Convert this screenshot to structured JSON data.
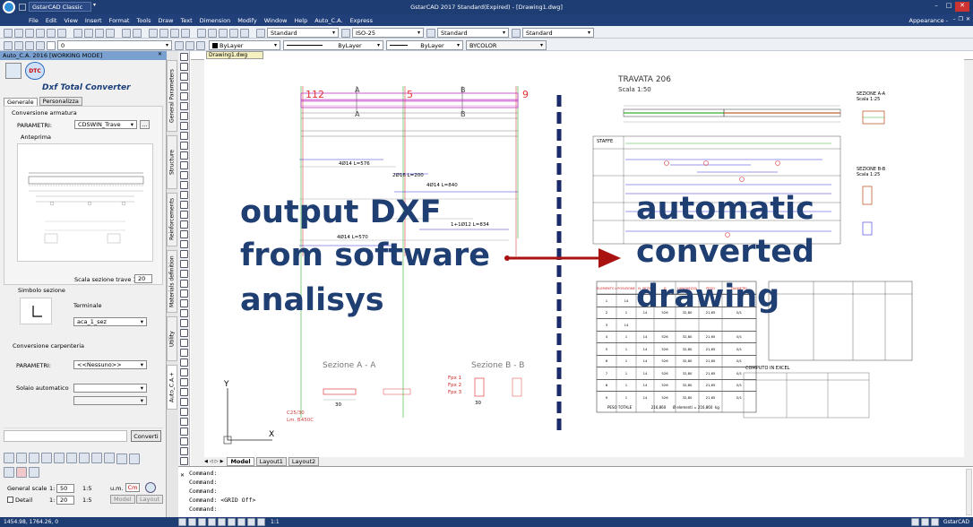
{
  "title": {
    "app_icon": "gstarcad-logo-icon",
    "workspace": "GstarCAD Classic",
    "window_title": "GstarCAD 2017 Standard(Expired) - [Drawing1.dwg]",
    "right": "Appearance -"
  },
  "menu": [
    "File",
    "Edit",
    "View",
    "Insert",
    "Format",
    "Tools",
    "Draw",
    "Text",
    "Dimension",
    "Modify",
    "Window",
    "Help",
    "Auto_C.A.",
    "Express"
  ],
  "toolbar": {
    "layer": "0",
    "textstyle": "Standard",
    "dimstyle": "ISO-25",
    "tablestyle": "Standard",
    "mleaderstyle": "Standard"
  },
  "props": {
    "color": "ByLayer",
    "linetype": "ByLayer",
    "lineweight": "ByLayer",
    "plotstyle": "BYCOLOR"
  },
  "panel": {
    "header": "Auto_C.A. 2016  [WORKING MODE]",
    "logo_text": "Dxf Total Converter",
    "tabs": [
      "Generale",
      "Personalizza"
    ],
    "armatura_title": "Conversione armatura",
    "parametri_label": "PARAMETRI:",
    "parametri_value": "CDSWIN_Trave",
    "dots": "...",
    "anteprima": "Anteprima",
    "scala_label": "Scala sezione trave 1:",
    "scala_value": "20",
    "simbolo_title": "Simbolo sezione",
    "terminale_label": "Terminale",
    "terminale_value": "aca_1_sez",
    "carpenteria_title": "Conversione carpenteria",
    "parametri2_label": "PARAMETRI:",
    "parametri2_value": "<<Nessuno>>",
    "solaio_label": "Solaio automatico",
    "converti": "Converti",
    "gen_scale_label": "General scale",
    "gen_scale_1": "1:",
    "gen_scale_val": "50",
    "gen_scale_2": "1:5",
    "um_label": "u.m.",
    "um_value": "Cm",
    "detail_label": "Detail",
    "detail_1": "1:",
    "detail_val": "20",
    "detail_2": "1:5",
    "model": "Model",
    "layout": "Layout"
  },
  "sidetabs": [
    "General Parameters",
    "Structure",
    "Reinforcements",
    "Materials definition",
    "Utility",
    "Auto_C.A.+"
  ],
  "drawing": {
    "tab": "Drawing1.dwg",
    "overlay_left": [
      "output DXF",
      "from software",
      "analisys"
    ],
    "overlay_right": [
      "automatic",
      "converted",
      "drawing"
    ],
    "left": {
      "n112": "112",
      "n5": "5",
      "n9": "9",
      "A1": "A",
      "B1": "B",
      "A2": "A",
      "B2": "B",
      "b1": "4Ø14 L=576",
      "b2": "2Ø16 L=200",
      "b3": "4Ø14 L=840",
      "b4": "1+1Ø12 L=834",
      "b5": "4Ø14 L=570",
      "sezA": "Sezione  A - A",
      "sezB": "Sezione  B - B",
      "s30a": "30",
      "s30b": "30",
      "fp1": "Fpx 1",
      "fp2": "Fpx 2",
      "fp3": "Fpx 3",
      "mat1": "C25/30",
      "mat2": "Lm. B450C",
      "ylab": "Y",
      "xlab": "X"
    },
    "right": {
      "title": "TRAVATA 206",
      "scale": "Scala 1:50",
      "staffe": "STAFFE",
      "sezAA": "SEZIONE A-A",
      "sezAAsc": "Scala 1:25",
      "sezBB": "SEZIONE B-B",
      "sezBBsc": "Scala 1:25",
      "computo": "COMPUTO IN EXCEL",
      "table_h": [
        "ELEMENTO Ø 100",
        "POSIZIONE",
        "N. PEZZI",
        "Ø",
        "LUNGHEZZA",
        "PESO",
        "DIAMETRI"
      ],
      "rows": [
        [
          "1",
          "14",
          "",
          "",
          "",
          "",
          ""
        ],
        [
          "2",
          "1",
          "14",
          "526",
          "32,80",
          "21,65",
          "0/1"
        ],
        [
          "3",
          "14",
          "",
          "",
          "",
          "",
          ""
        ],
        [
          "4",
          "1",
          "14",
          "526",
          "32,80",
          "21,65",
          "0/1"
        ],
        [
          "5",
          "1",
          "14",
          "526",
          "32,80",
          "21,65",
          "0/1"
        ],
        [
          "6",
          "1",
          "14",
          "526",
          "32,80",
          "21,65",
          "0/1"
        ],
        [
          "7",
          "1",
          "14",
          "526",
          "32,80",
          "21,65",
          "0/1"
        ],
        [
          "8",
          "1",
          "14",
          "526",
          "32,80",
          "21,65",
          "0/1"
        ],
        [
          "9",
          "1",
          "14",
          "526",
          "32,80",
          "21,65",
          "0/1"
        ]
      ],
      "table_footer": "PESO TOTALE                 216,860      Ø elementi = 216,860  kg"
    }
  },
  "layout_tabs": [
    "Model",
    "Layout1",
    "Layout2"
  ],
  "command_lines": [
    "Command:",
    "Command:",
    "Command:",
    "Command: <GRID Off>",
    "Command:"
  ],
  "status": {
    "coords": "1454.98, 1764.26, 0",
    "scale": "1:1",
    "brand": "GstarCAD"
  }
}
